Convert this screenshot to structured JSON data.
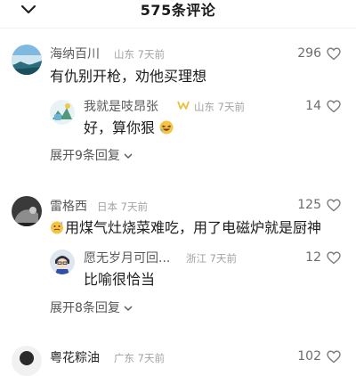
{
  "header": {
    "title": "575条评论"
  },
  "comments": [
    {
      "user": "海纳百川",
      "location": "山东",
      "time": "7天前",
      "text": "有仇别开枪，劝他买理想",
      "likes": "296",
      "reply": {
        "user": "我就是吱昂张",
        "location": "山东",
        "time": "7天前",
        "text": "好，算你狠",
        "likes": "14"
      },
      "expand": "展开9条回复"
    },
    {
      "user": "雷格西",
      "location": "日本",
      "time": "7天前",
      "text": "用煤气灶烧菜难吃，用了电磁炉就是厨神",
      "likes": "125",
      "reply": {
        "user": "愿无岁月可回...",
        "location": "浙江",
        "time": "7天前",
        "text": "比喻很恰当",
        "likes": "12"
      },
      "expand": "展开8条回复"
    },
    {
      "user": "粤花粽油",
      "location": "广东",
      "time": "7天前",
      "likes": "102"
    }
  ],
  "icons": {
    "collapse": "chevron-down-icon",
    "like": "heart-outline-icon",
    "expand": "chevron-down-small-icon",
    "author_badge": "author-badge-icon"
  },
  "colors": {
    "muted": "#a2a2a2",
    "badge": "#e8c23a"
  }
}
